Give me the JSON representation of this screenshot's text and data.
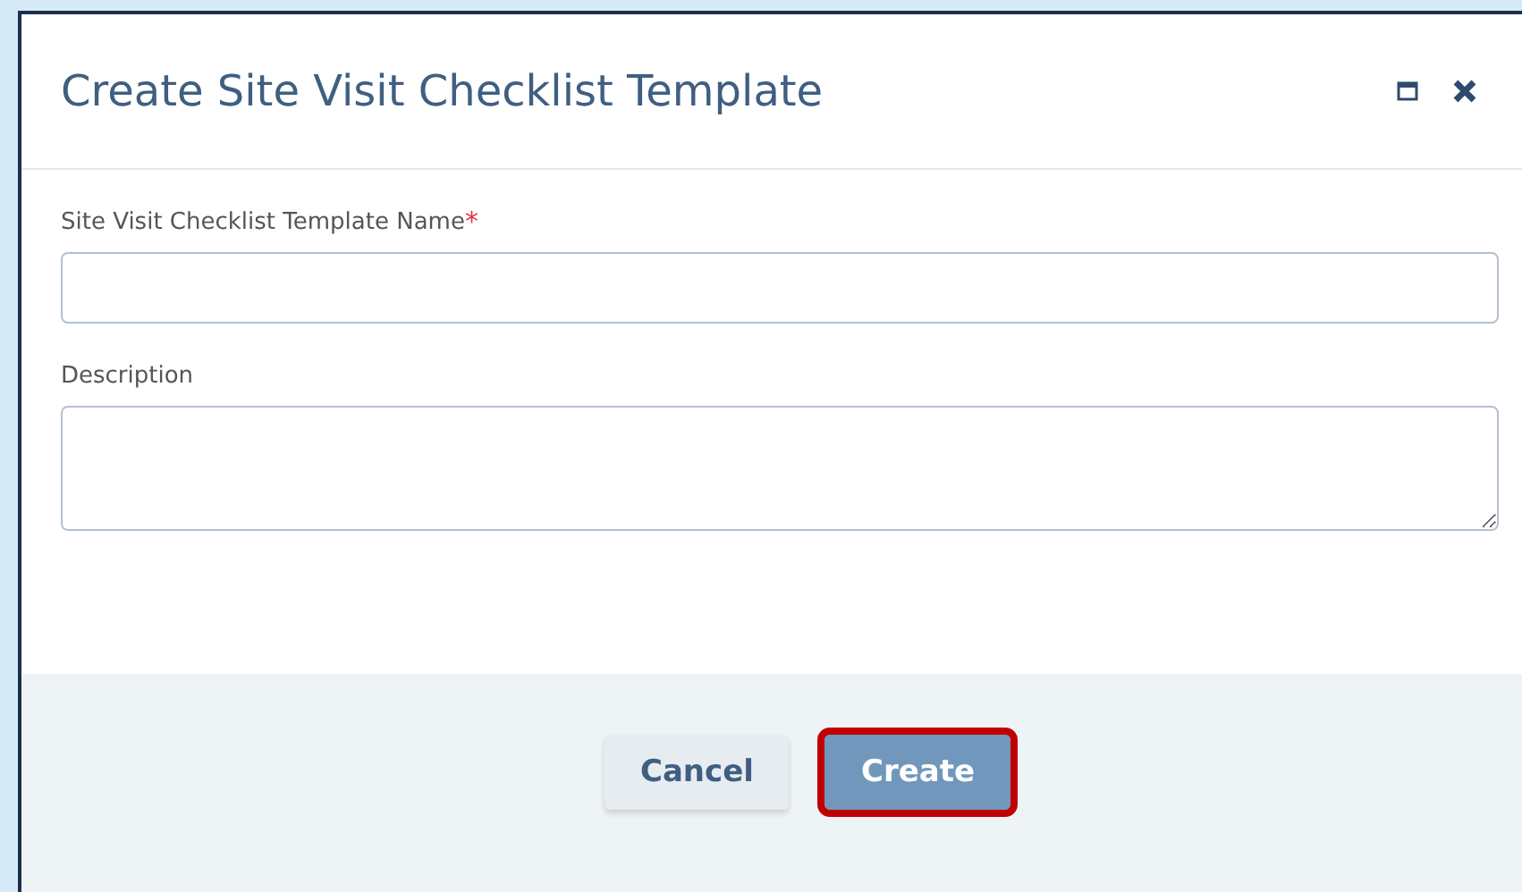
{
  "dialog": {
    "title": "Create Site Visit Checklist Template"
  },
  "fields": [
    {
      "kind": "input",
      "label": "Site Visit Checklist Template Name",
      "required_mark": "*"
    },
    {
      "kind": "textarea",
      "label": "Description"
    }
  ],
  "buttons": [
    {
      "kind": "secondary",
      "label": "Cancel",
      "highlighted": false
    },
    {
      "kind": "primary",
      "label": "Create",
      "highlighted": true
    }
  ]
}
